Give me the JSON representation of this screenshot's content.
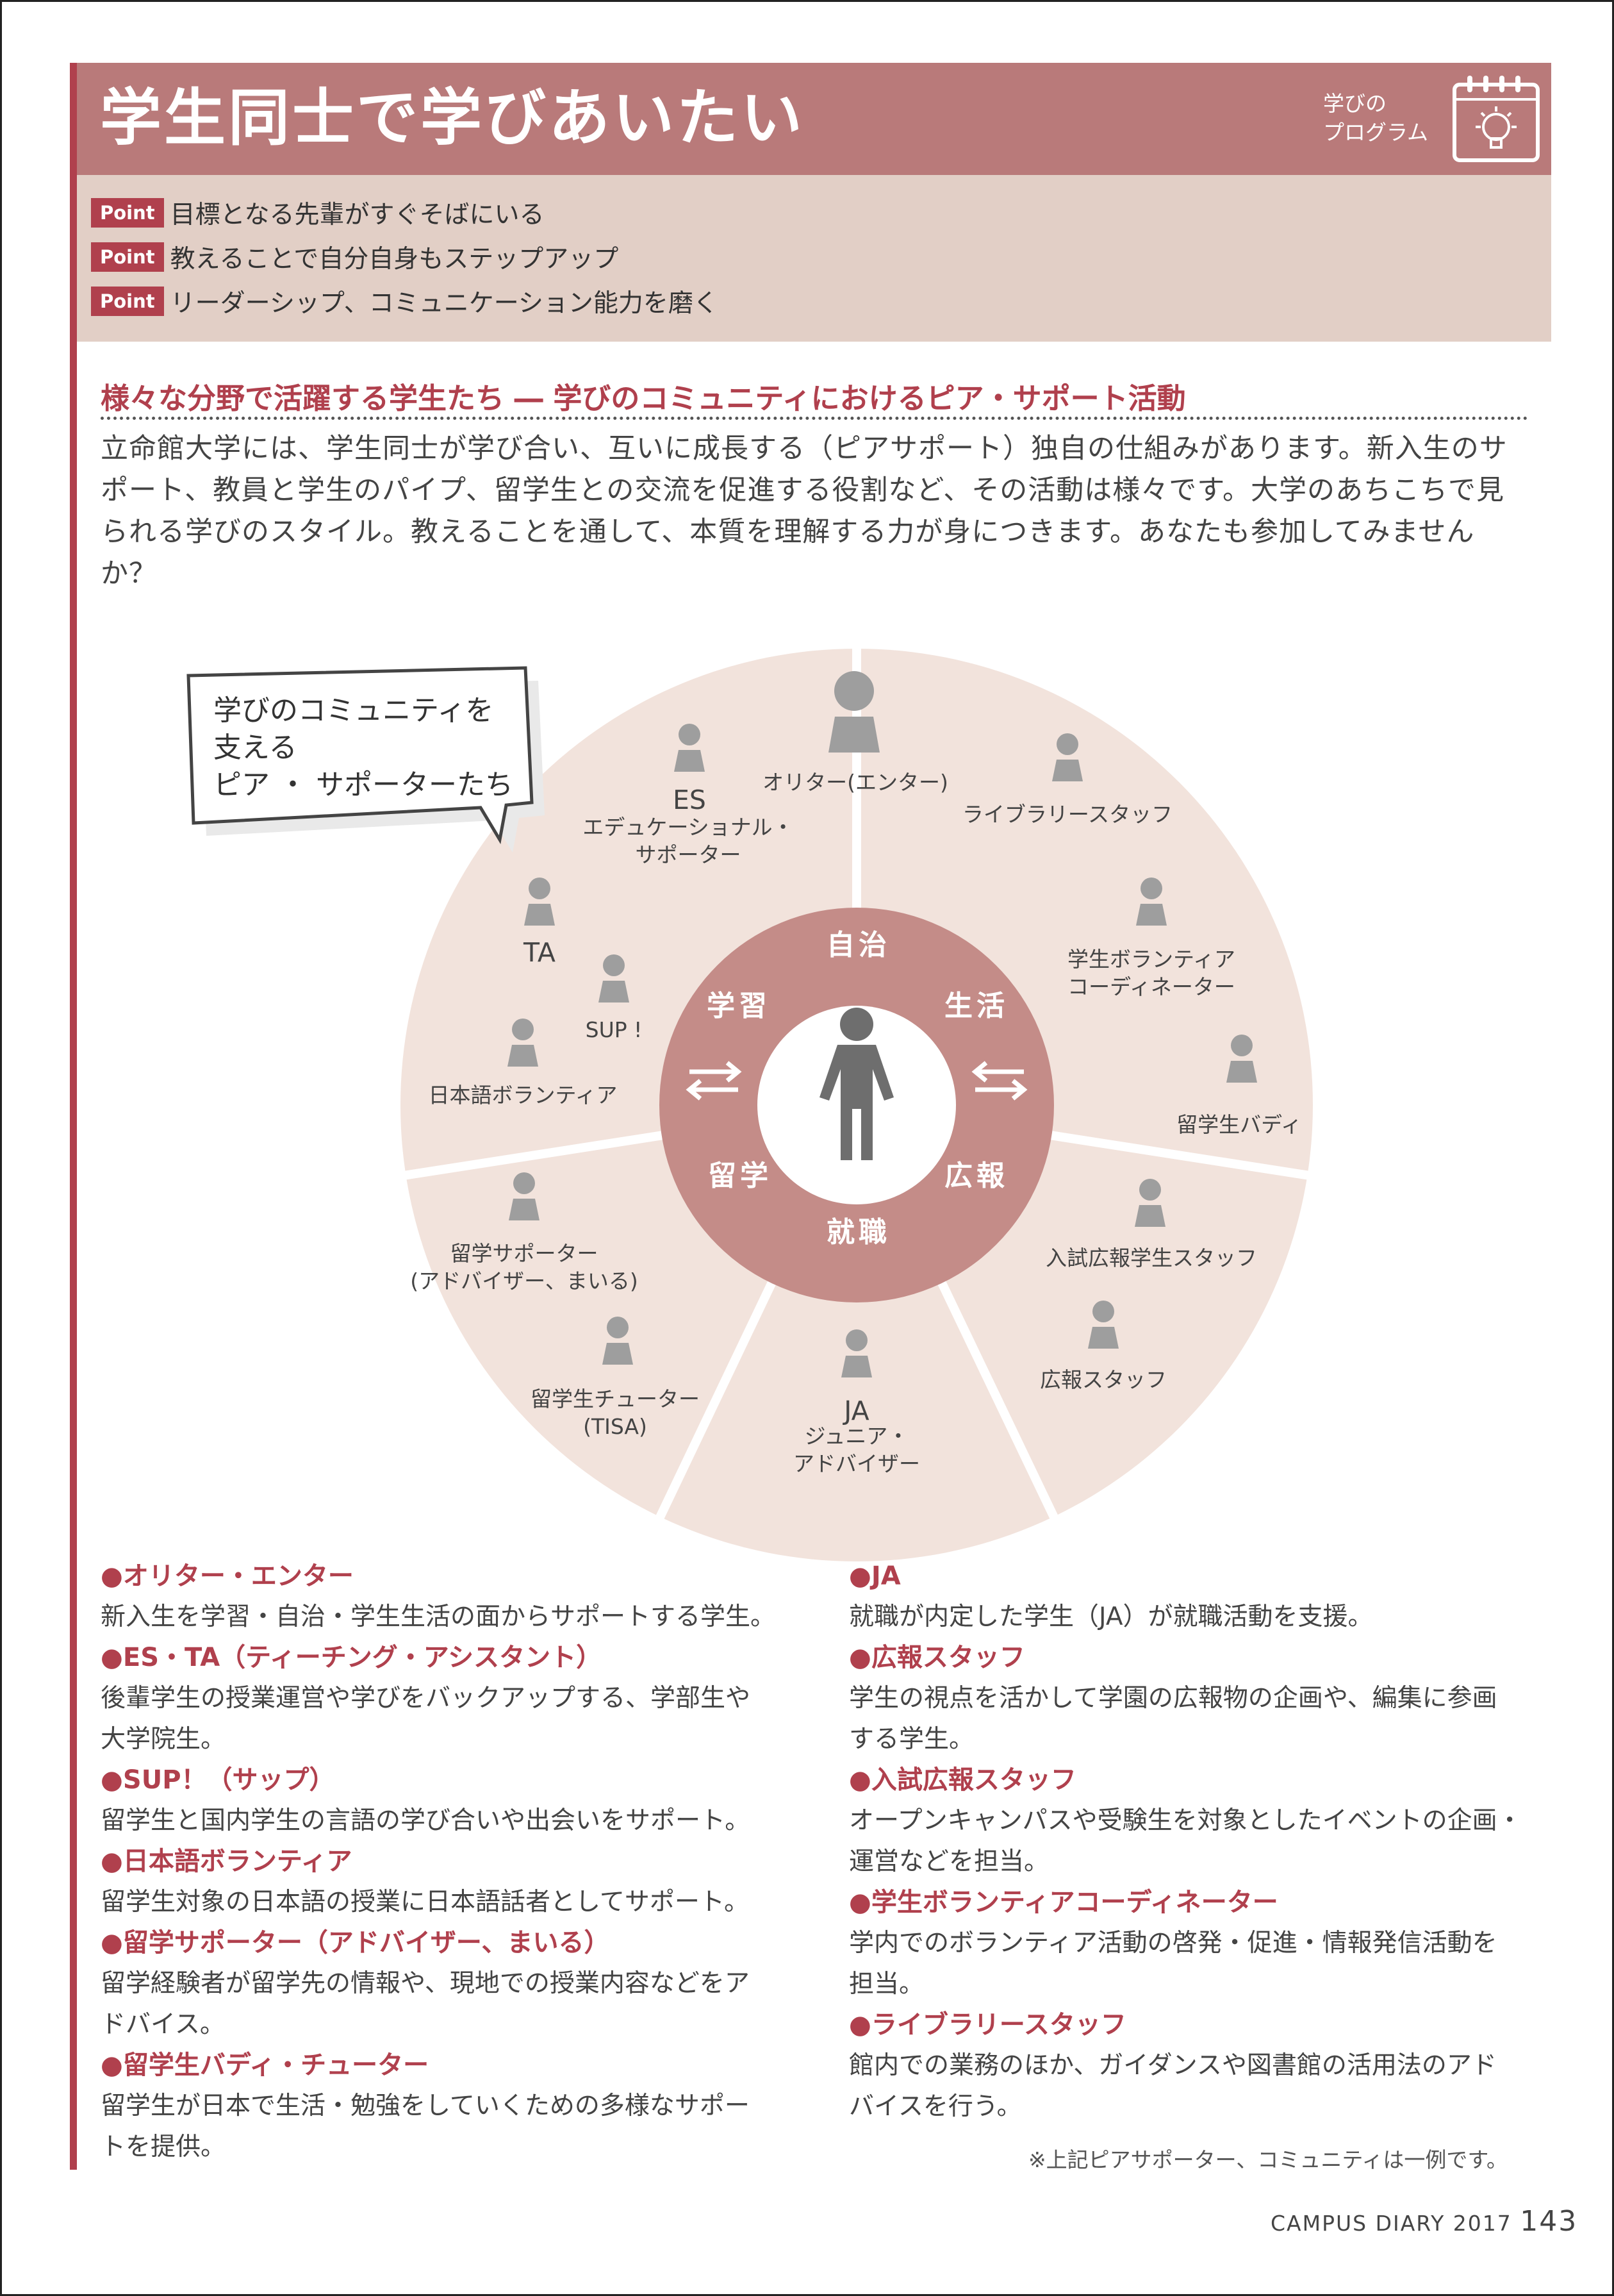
{
  "header": {
    "title": "学生同士で学びあいたい",
    "program_label": [
      "学びの",
      "プログラム"
    ]
  },
  "points": {
    "badge": "Point",
    "items": [
      "目標となる先輩がすぐそばにいる",
      "教えることで自分自身もステップアップ",
      "リーダーシップ、コミュニケーション能力を磨く"
    ]
  },
  "section": {
    "heading": "様々な分野で活躍する学生たち ― 学びのコミュニティにおけるピア・サポート活動",
    "intro": "立命館大学には、学生同士が学び合い、互いに成長する（ピアサポート）独自の仕組みがあります。新入生のサポート、教員と学生のパイプ、留学生との交流を促進する役割など、その活動は様々です。大学のあちこちで見られる学びのスタイル。教えることを通して、本質を理解する力が身につきます。あなたも参加してみませんか？"
  },
  "diagram": {
    "speech": "学びのコミュニティを\n支える\nピア ・ サポーターたち",
    "topics": {
      "autonomy": "自治",
      "study": "学習",
      "life": "生活",
      "abroad": "留学",
      "pr": "広報",
      "career": "就職"
    },
    "roles": {
      "orientar": "オリター(エンター)",
      "es_abbr": "ES",
      "es_name": [
        "エデュケーショナル・",
        "サポーター"
      ],
      "library": "ライブラリースタッフ",
      "ta": "TA",
      "sup": "SUP !",
      "volunteer_coord": [
        "学生ボランティア",
        "コーディネーター"
      ],
      "japanese_volunteer": "日本語ボランティア",
      "buddy": "留学生バディ",
      "study_abroad_supporter": [
        "留学サポーター",
        "(アドバイザー、まいる)"
      ],
      "admissions_pr": "入試広報学生スタッフ",
      "tutor": [
        "留学生チューター",
        "(TISA)"
      ],
      "pr_staff": "広報スタッフ",
      "ja_abbr": "JA",
      "ja_name": [
        "ジュニア・",
        "アドバイザー"
      ]
    }
  },
  "descriptions": {
    "left": [
      {
        "title": "●オリター・エンター",
        "body": [
          "新入生を学習・自治・学生生活の面からサポートする学生。"
        ]
      },
      {
        "title": "●ES・TA（ティーチング・アシスタント）",
        "body": [
          "後輩学生の授業運営や学びをバックアップする、学部生や",
          "大学院生。"
        ]
      },
      {
        "title": "●SUP！（サップ）",
        "body": [
          "留学生と国内学生の言語の学び合いや出会いをサポート。"
        ]
      },
      {
        "title": "●日本語ボランティア",
        "body": [
          "留学生対象の日本語の授業に日本語話者としてサポート。"
        ]
      },
      {
        "title": "●留学サポーター（アドバイザー、まいる）",
        "body": [
          "留学経験者が留学先の情報や、現地での授業内容などをア",
          "ドバイス。"
        ]
      },
      {
        "title": "●留学生バディ・チューター",
        "body": [
          "留学生が日本で生活・勉強をしていくための多様なサポー",
          "トを提供。"
        ]
      }
    ],
    "right": [
      {
        "title": "●JA",
        "body": [
          "就職が内定した学生（JA）が就職活動を支援。"
        ]
      },
      {
        "title": "●広報スタッフ",
        "body": [
          "学生の視点を活かして学園の広報物の企画や、編集に参画",
          "する学生。"
        ]
      },
      {
        "title": "●入試広報スタッフ",
        "body": [
          "オープンキャンパスや受験生を対象としたイベントの企画・",
          "運営などを担当。"
        ]
      },
      {
        "title": "●学生ボランティアコーディネーター",
        "body": [
          "学内でのボランティア活動の啓発・促進・情報発信活動を",
          "担当。"
        ]
      },
      {
        "title": "●ライブラリースタッフ",
        "body": [
          "館内での業務のほか、ガイダンスや図書館の活用法のアド",
          "バイスを行う。"
        ]
      }
    ]
  },
  "note": "※上記ピアサポーター、コミュニティは一例です。",
  "footer": {
    "publication": "CAMPUS DIARY 2017",
    "page": "143"
  },
  "colors": {
    "accent": "#b0404d",
    "header": "#b97a7a",
    "band": "#e2cfc6",
    "outer_ring": "#f2e3dc",
    "inner_ring": "#c48c88",
    "person": "#9e9e9e"
  }
}
